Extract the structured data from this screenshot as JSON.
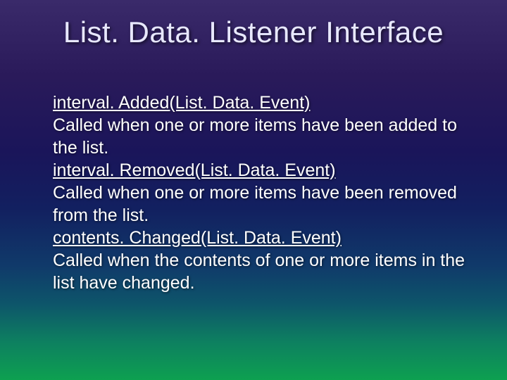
{
  "title": "List. Data. Listener Interface",
  "items": [
    {
      "method": "interval. Added(List. Data. Event)",
      "desc": "Called when one or more items have been added to the list."
    },
    {
      "method": "interval. Removed(List. Data. Event)",
      "desc": "Called when one or more items have been removed from the list."
    },
    {
      "method": "contents. Changed(List. Data. Event)",
      "desc": "Called when the contents of one or more items in the list have changed."
    }
  ]
}
